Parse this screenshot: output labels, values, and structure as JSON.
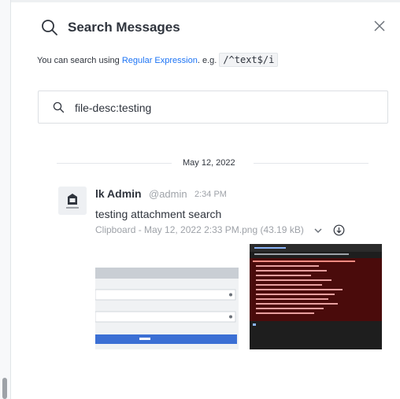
{
  "header": {
    "title": "Search Messages",
    "search_icon": "search-icon",
    "close_icon": "close-icon"
  },
  "hint": {
    "prefix": "You can search using ",
    "link": "Regular Expression",
    "suffix": ". e.g.",
    "example": "/^text$/i"
  },
  "search": {
    "value": "file-desc:testing",
    "icon": "search-icon"
  },
  "results": {
    "date": "May 12, 2022",
    "message": {
      "author": "lk Admin",
      "username": "@admin",
      "time": "2:34 PM",
      "text": "testing attachment search",
      "attachment_name": "Clipboard - May 12, 2022 2:33 PM.png (43.19 kB)"
    }
  },
  "colors": {
    "accent": "#1d74f5",
    "text": "#2f343d",
    "muted": "#9ea2a8",
    "border": "#dcdfe3"
  }
}
